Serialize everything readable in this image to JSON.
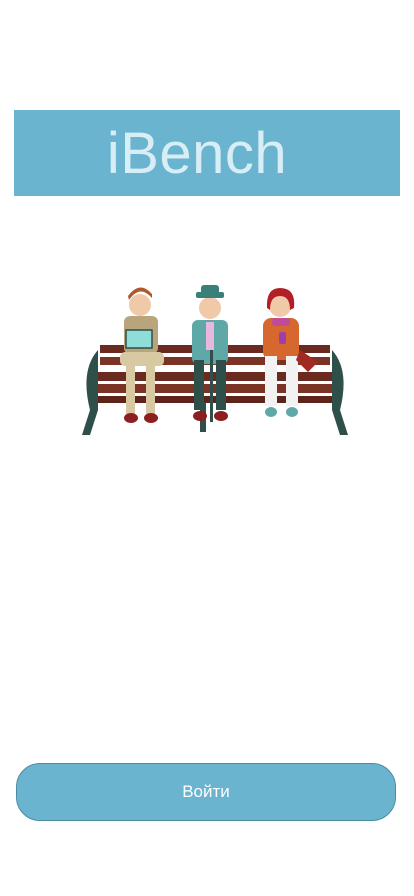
{
  "app": {
    "title": "iBench"
  },
  "illustration": {
    "icon": "people-on-bench-illustration"
  },
  "actions": {
    "login_label": "Войти"
  },
  "colors": {
    "accent": "#6ab4d0",
    "title_text": "#d7eef6"
  }
}
